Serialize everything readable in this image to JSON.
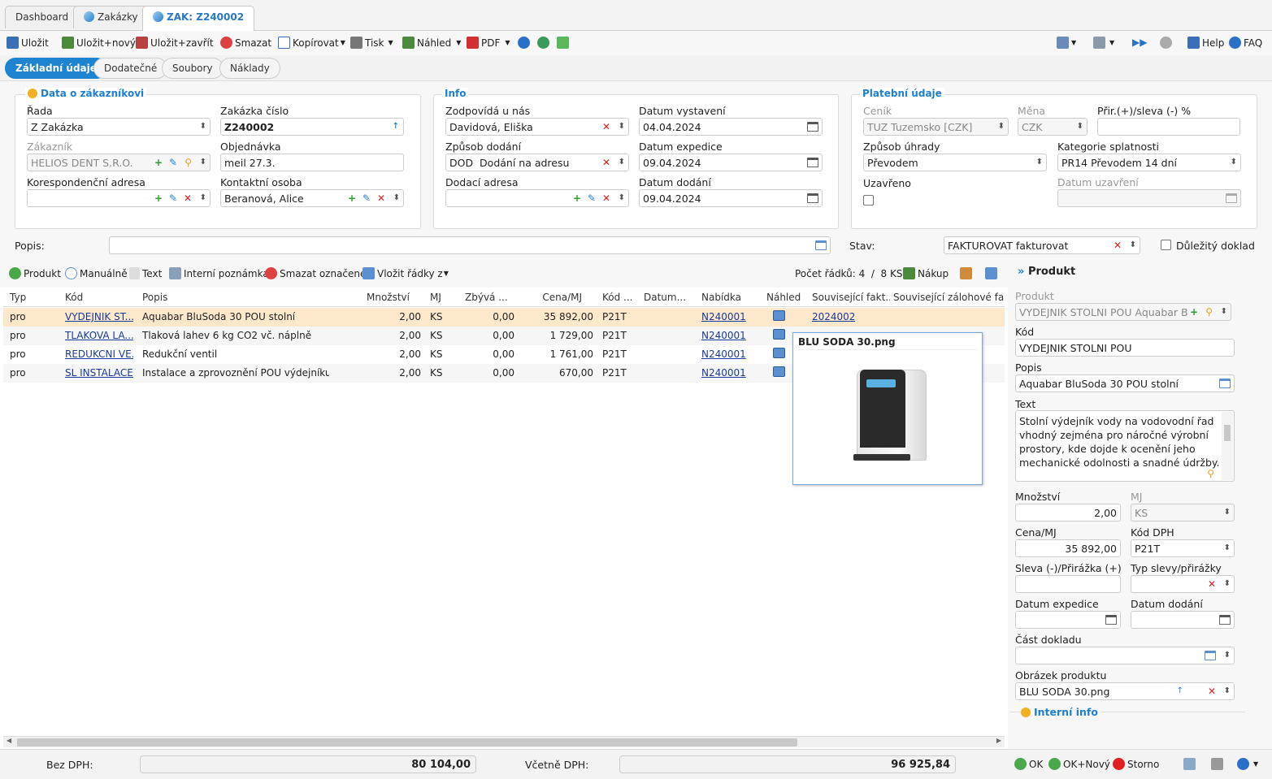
{
  "tabs": [
    {
      "label": "Dashboard"
    },
    {
      "label": "Zakázky"
    },
    {
      "label": "ZAK: Z240002"
    }
  ],
  "toolbar": {
    "save": "Uložit",
    "save_new": "Uložit+nový",
    "save_close": "Uložit+zavřít",
    "delete": "Smazat",
    "copy": "Kopírovat",
    "print": "Tisk",
    "preview": "Náhled",
    "pdf": "PDF",
    "help": "Help",
    "faq": "FAQ"
  },
  "subtabs": [
    "Základní údaje",
    "Dodatečné",
    "Soubory",
    "Náklady"
  ],
  "customer": {
    "legend": "Data o zákazníkovi",
    "rada_label": "Řada",
    "rada": "Z Zakázka",
    "cislo_label": "Zakázka číslo",
    "cislo": "Z240002",
    "zakaznik_label": "Zákazník",
    "zakaznik": "HELIOS DENT S.R.O.",
    "objednavka_label": "Objednávka",
    "objednavka": "meil 27.3.",
    "kor_label": "Korespondenční adresa",
    "kor": "",
    "kontakt_label": "Kontaktní osoba",
    "kontakt": "Beranová, Alice"
  },
  "info": {
    "legend": "Info",
    "zodp_label": "Zodpovídá u nás",
    "zodp": "Davidová, Eliška",
    "vyst_label": "Datum vystavení",
    "vyst": "04.04.2024",
    "zpusob_label": "Způsob dodání",
    "zpusob_code": "DOD",
    "zpusob": "Dodání na adresu",
    "exped_label": "Datum expedice",
    "exped": "09.04.2024",
    "dodaci_label": "Dodací adresa",
    "dodaci": "",
    "dodani_label": "Datum dodání",
    "dodani": "09.04.2024"
  },
  "payment": {
    "legend": "Platební údaje",
    "cenik_label": "Ceník",
    "cenik": "TUZ Tuzemsko [CZK]",
    "mena_label": "Měna",
    "mena": "CZK",
    "sleva_label": "Přir.(+)/sleva (-) %",
    "sleva": "",
    "uhrada_label": "Způsob úhrady",
    "uhrada": "Převodem",
    "kat_label": "Kategorie splatnosti",
    "kat": "PR14 Převodem 14 dní",
    "uzavreno_label": "Uzavřeno",
    "datum_uz_label": "Datum uzavření",
    "datum_uz": ""
  },
  "popis": {
    "label": "Popis:",
    "value": ""
  },
  "stav": {
    "label": "Stav:",
    "value": "FAKTUROVAT fakturovat",
    "important": "Důležitý doklad"
  },
  "grid_toolbar": {
    "produkt": "Produkt",
    "manual": "Manuálně",
    "text": "Text",
    "note": "Interní poznámka",
    "del": "Smazat označené",
    "insert": "Vložit řádky z",
    "count": "Počet řádků: 4  /  8 KS",
    "nakup": "Nákup"
  },
  "grid_headers": [
    "Typ",
    "Kód",
    "Popis",
    "Množství",
    "MJ",
    "Zbývá ...",
    "Cena/MJ",
    "Kód ...",
    "Datum...",
    "Nabídka",
    "Náhled",
    "Související fakt...",
    "Související zálohové fakt..."
  ],
  "rows": [
    {
      "typ": "pro",
      "kod": "VYDEJNIK ST...",
      "popis": "Aquabar BluSoda 30 POU stolní",
      "mn": "2,00",
      "mj": "KS",
      "zb": "0,00",
      "cena": "35 892,00",
      "kd": "P21T",
      "nab": "N240001",
      "fakt": "2024002"
    },
    {
      "typ": "pro",
      "kod": "TLAKOVA LA...",
      "popis": "Tlaková lahev 6 kg CO2 vč. náplně",
      "mn": "2,00",
      "mj": "KS",
      "zb": "0,00",
      "cena": "1 729,00",
      "kd": "P21T",
      "nab": "N240001",
      "fakt": ""
    },
    {
      "typ": "pro",
      "kod": "REDUKCNI VE...",
      "popis": "Redukční ventil",
      "mn": "2,00",
      "mj": "KS",
      "zb": "0,00",
      "cena": "1 761,00",
      "kd": "P21T",
      "nab": "N240001",
      "fakt": ""
    },
    {
      "typ": "pro",
      "kod": "SL INSTALACE...",
      "popis": "Instalace a zprovoznění POU výdejníku v...",
      "mn": "2,00",
      "mj": "KS",
      "zb": "0,00",
      "cena": "670,00",
      "kd": "P21T",
      "nab": "N240001",
      "fakt": ""
    }
  ],
  "preview_popup": {
    "title": "BLU SODA 30.png"
  },
  "product_panel": {
    "title": "Produkt",
    "produkt_label": "Produkt",
    "produkt": "VYDEJNIK STOLNI POU Aquabar Bl",
    "kod_label": "Kód",
    "kod": "VYDEJNIK STOLNI POU",
    "popis_label": "Popis",
    "popis": "Aquabar BluSoda 30 POU stolní",
    "text_label": "Text",
    "text": "Stolní výdejník vody na vodovodní řad vhodný zejména pro náročné výrobní prostory, kde dojde k ocenění jeho mechanické odolnosti a snadné údržby.",
    "mn_label": "Množství",
    "mn": "2,00",
    "mj_label": "MJ",
    "mj": "KS",
    "cena_label": "Cena/MJ",
    "cena": "35 892,00",
    "dph_label": "Kód DPH",
    "dph": "P21T",
    "sleva_label": "Sleva (-)/Přirážka (+)",
    "sleva": "",
    "typ_label": "Typ slevy/přirážky",
    "typ": "",
    "exp_label": "Datum expedice",
    "exp": "",
    "dod_label": "Datum dodání",
    "dod": "",
    "cast_label": "Část dokladu",
    "cast": "",
    "obr_label": "Obrázek produktu",
    "obr": "BLU SODA 30.png",
    "interni": "Interní info"
  },
  "footer": {
    "bez_label": "Bez DPH:",
    "bez": "80 104,00",
    "vc_label": "Včetně DPH:",
    "vc": "96 925,84",
    "ok": "OK",
    "ok_new": "OK+Nový",
    "storno": "Storno"
  }
}
